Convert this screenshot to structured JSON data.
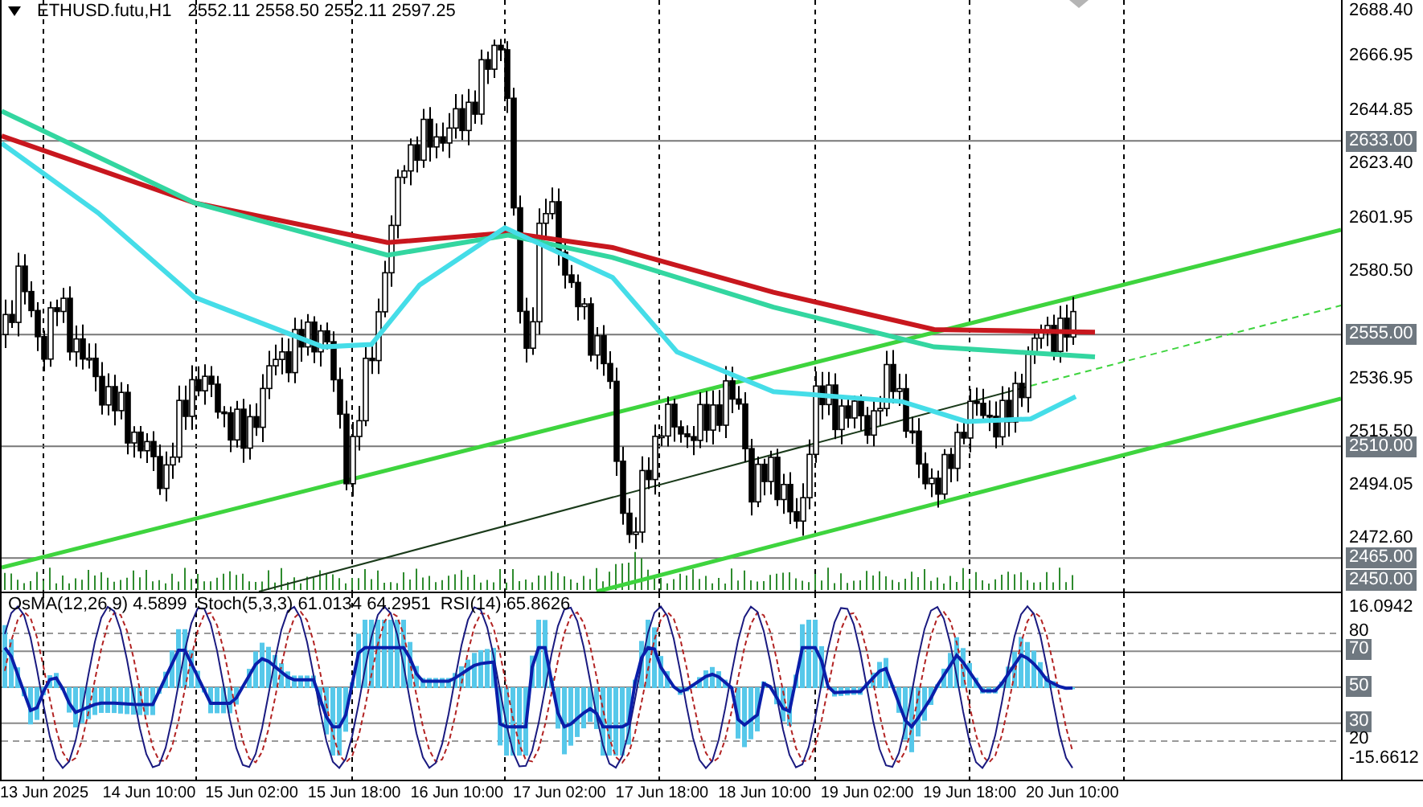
{
  "chart_header": {
    "symbol": "ETHUSD.futu,H1",
    "prices": "2552.11 2558.50 2552.11 2597.25"
  },
  "price_axis": [
    {
      "label": "2688.40",
      "boxed": false
    },
    {
      "label": "2666.95",
      "boxed": false
    },
    {
      "label": "2644.85",
      "boxed": false
    },
    {
      "label": "2633.00",
      "boxed": true
    },
    {
      "label": "2623.40",
      "boxed": false
    },
    {
      "label": "2601.95",
      "boxed": false
    },
    {
      "label": "2580.50",
      "boxed": false
    },
    {
      "label": "2555.00",
      "boxed": true
    },
    {
      "label": "2536.95",
      "boxed": false
    },
    {
      "label": "2515.50",
      "boxed": false
    },
    {
      "label": "2510.00",
      "boxed": true
    },
    {
      "label": "2494.05",
      "boxed": false
    },
    {
      "label": "2472.60",
      "boxed": false
    },
    {
      "label": "2465.00",
      "boxed": true
    },
    {
      "label": "2450.00",
      "boxed": true
    }
  ],
  "indicator_header": [
    {
      "text": "OsMA(12,26,9) 4.5899"
    },
    {
      "text": "Stoch(5,3,3) 61.0134 64.2951"
    },
    {
      "text": "RSI(14) 65.8626"
    }
  ],
  "indicator_axis": [
    {
      "label": "16.0942",
      "kind": "max",
      "boxed": false
    },
    {
      "label": "80",
      "kind": "level",
      "boxed": false
    },
    {
      "label": "70",
      "kind": "level",
      "boxed": true
    },
    {
      "label": "50",
      "kind": "level",
      "boxed": true
    },
    {
      "label": "30",
      "kind": "level",
      "boxed": true
    },
    {
      "label": "20",
      "kind": "level",
      "boxed": false
    },
    {
      "label": "-15.6612",
      "kind": "min",
      "boxed": false
    }
  ],
  "time_axis": [
    "13 Jun 2025",
    "14 Jun 10:00",
    "15 Jun 02:00",
    "15 Jun 18:00",
    "16 Jun 10:00",
    "17 Jun 02:00",
    "17 Jun 18:00",
    "18 Jun 10:00",
    "19 Jun 02:00",
    "19 Jun 18:00",
    "20 Jun 10:00"
  ]
}
